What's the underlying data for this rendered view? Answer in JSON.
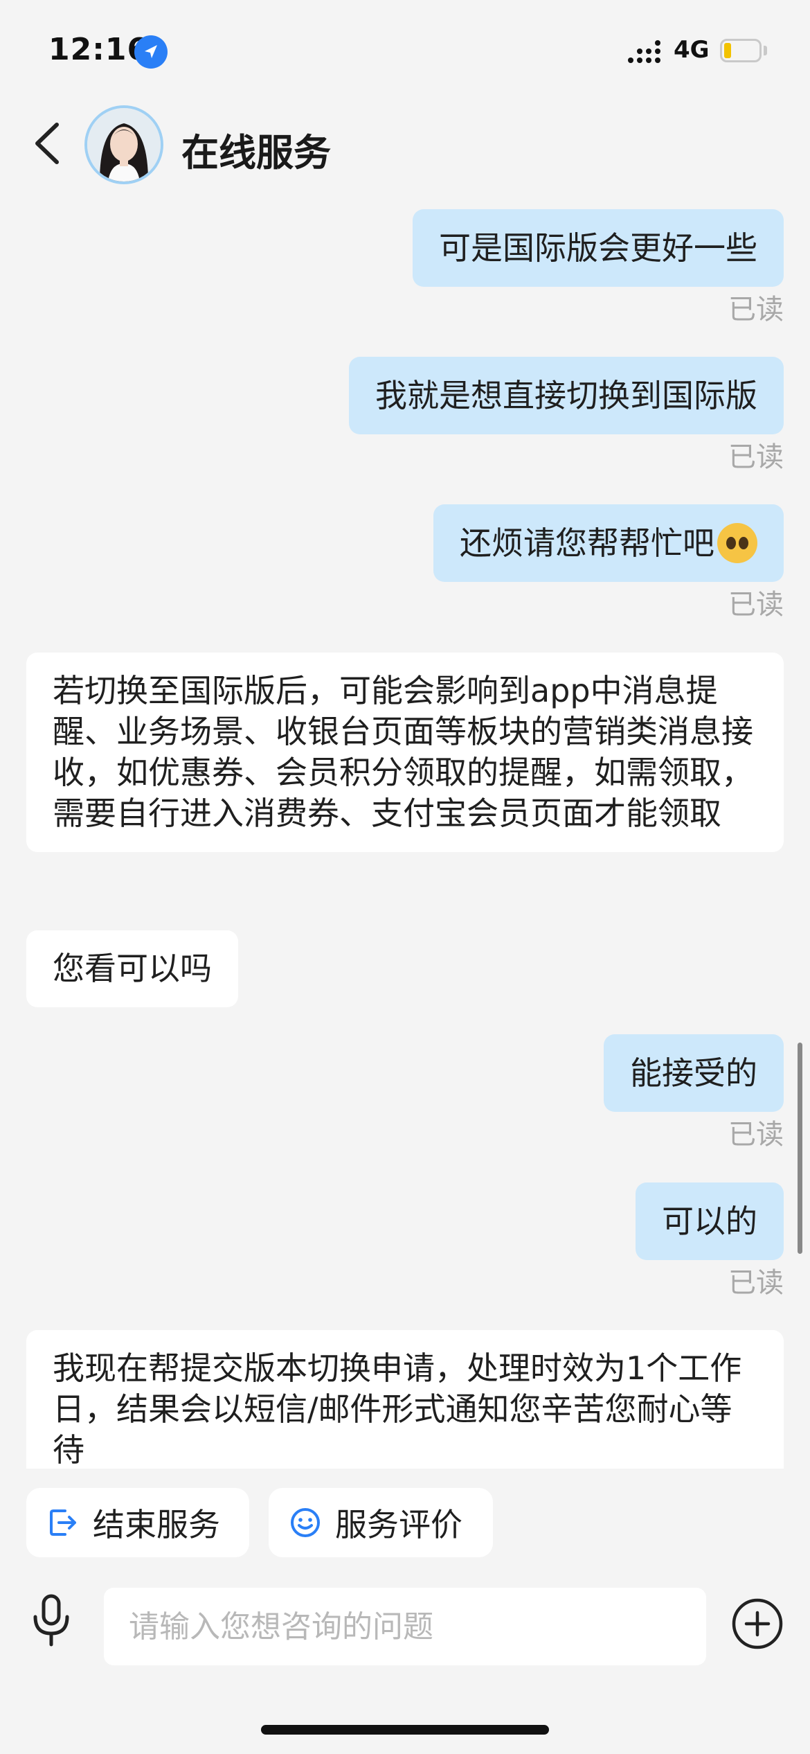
{
  "status_bar": {
    "time": "12:16",
    "network": "4G",
    "location_icon": "location-arrow-icon",
    "signal_icon": "signal-icon",
    "battery_icon": "battery-low-icon"
  },
  "header": {
    "title": "在线服务",
    "back_icon": "chevron-left-icon",
    "avatar": "agent-avatar"
  },
  "messages": [
    {
      "from": "user",
      "text": "可是国际版会更好一些",
      "status": "已读"
    },
    {
      "from": "user",
      "text": "我就是想直接切换到国际版",
      "status": "已读"
    },
    {
      "from": "user",
      "text": "还烦请您帮帮忙吧",
      "emoji": "pleading-face-emoji",
      "status": "已读"
    },
    {
      "from": "agent",
      "text": "若切换至国际版后，可能会影响到app中消息提醒、业务场景、收银台页面等板块的营销类消息接收，如优惠券、会员积分领取的提醒，如需领取，需要自行进入消费券、支付宝会员页面才能领取"
    },
    {
      "from": "agent",
      "text": "您看可以吗"
    },
    {
      "from": "user",
      "text": "能接受的",
      "status": "已读"
    },
    {
      "from": "user",
      "text": "可以的",
      "status": "已读"
    },
    {
      "from": "agent",
      "text": "我现在帮提交版本切换申请，处理时效为1个工作日，结果会以短信/邮件形式通知您辛苦您耐心等待"
    }
  ],
  "actions": {
    "end_service": "结束服务",
    "rate_service": "服务评价"
  },
  "composer": {
    "placeholder": "请输入您想咨询的问题",
    "mic_icon": "microphone-icon",
    "plus_icon": "plus-circle-icon"
  },
  "colors": {
    "user_bubble": "#cde8fb",
    "agent_bubble": "#ffffff",
    "background": "#f4f4f4",
    "accent": "#2a7ff6",
    "read_text": "#a8a8a8"
  }
}
